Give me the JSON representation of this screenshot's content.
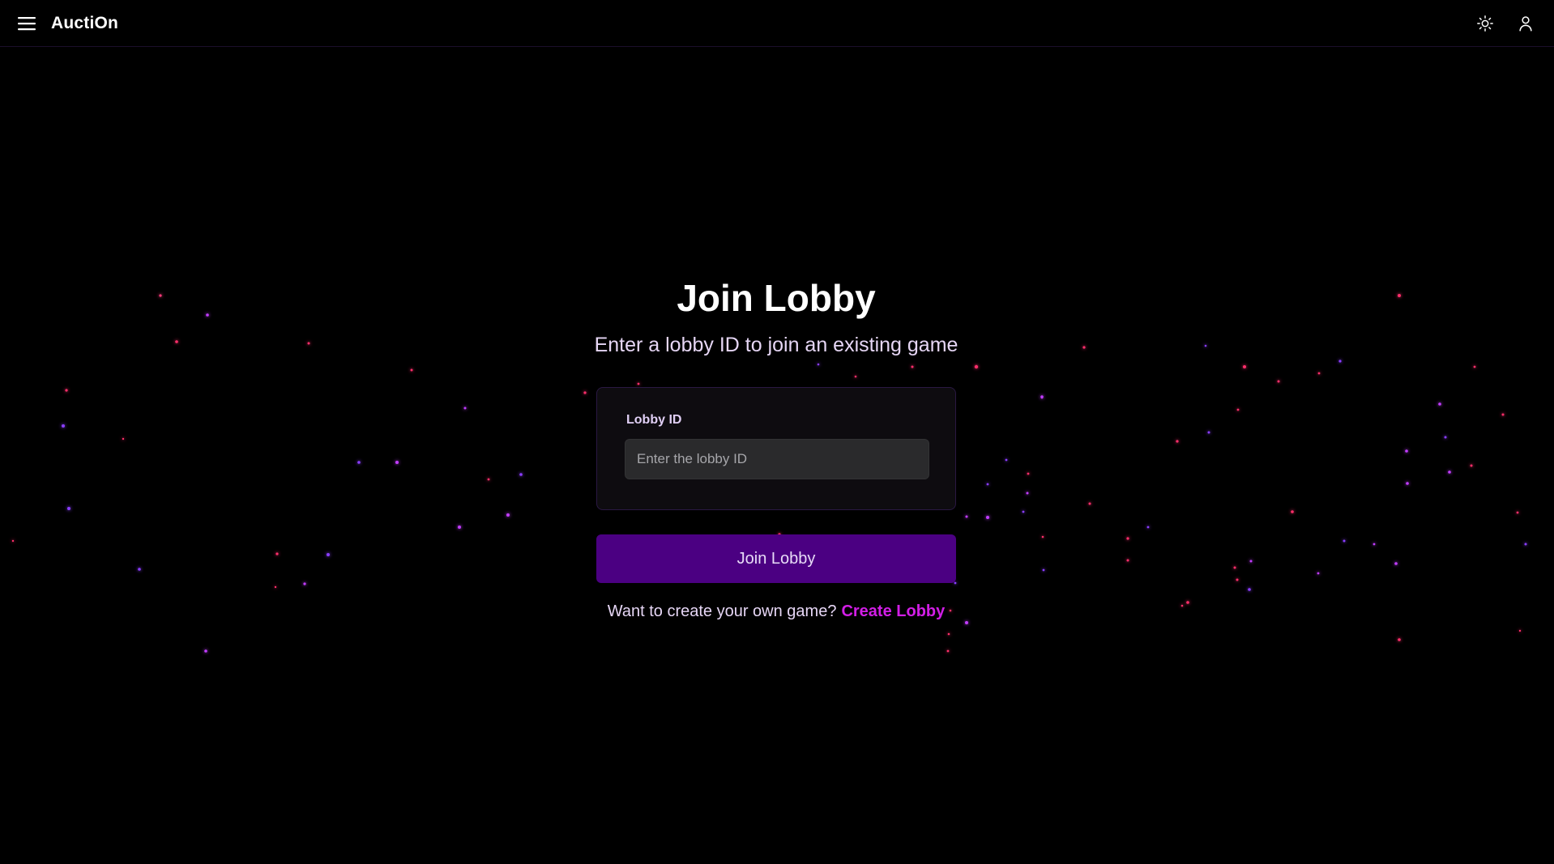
{
  "header": {
    "brand": "AuctiOn",
    "menu_icon": "hamburger-menu-icon",
    "theme_icon": "sun-icon",
    "profile_icon": "user-icon"
  },
  "main": {
    "title": "Join Lobby",
    "subtitle": "Enter a lobby ID to join an existing game",
    "form": {
      "label": "Lobby ID",
      "placeholder": "Enter the lobby ID",
      "value": ""
    },
    "join_button": "Join Lobby",
    "footer_prompt": "Want to create your own game?",
    "create_link": "Create Lobby"
  },
  "colors": {
    "background": "#000000",
    "accent": "#4b0082",
    "link": "#d21ee6",
    "star_pink": "#ff2d6a",
    "star_purple": "#9b3dff"
  }
}
